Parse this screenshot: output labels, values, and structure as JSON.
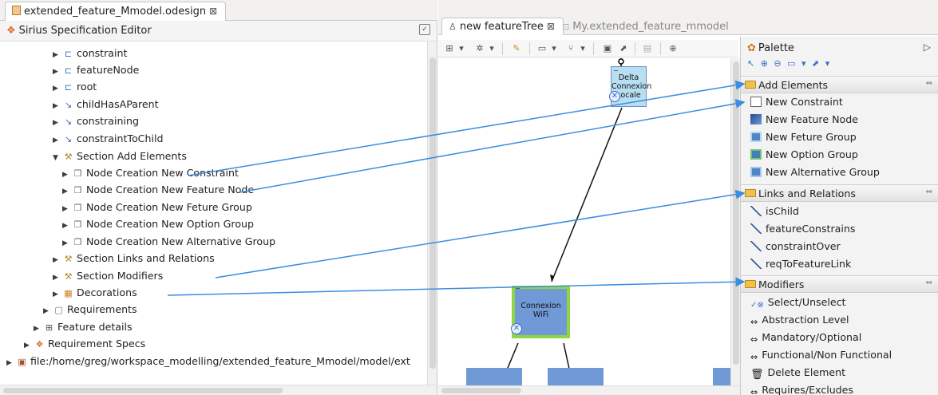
{
  "left_editor": {
    "tab_title": "extended_feature_Mmodel.odesign",
    "tab_close": "⊠",
    "header_title": "Sirius Specification Editor",
    "tree": [
      {
        "label": "constraint",
        "icon": "node-mapping-icon"
      },
      {
        "label": "featureNode",
        "icon": "node-mapping-icon"
      },
      {
        "label": "root",
        "icon": "node-mapping-icon"
      },
      {
        "label": "childHasAParent",
        "icon": "edge-mapping-icon"
      },
      {
        "label": "constraining",
        "icon": "edge-mapping-icon"
      },
      {
        "label": "constraintToChild",
        "icon": "edge-mapping-icon"
      },
      {
        "label": "Section Add Elements",
        "icon": "section-icon"
      },
      {
        "label": "Node Creation New Constraint",
        "icon": "node-creation-icon"
      },
      {
        "label": "Node Creation New Feature Node",
        "icon": "node-creation-icon"
      },
      {
        "label": "Node Creation New Feture Group",
        "icon": "node-creation-icon"
      },
      {
        "label": "Node Creation New Option Group",
        "icon": "node-creation-icon"
      },
      {
        "label": "Node Creation New Alternative Group",
        "icon": "node-creation-icon"
      },
      {
        "label": "Section Links and Relations",
        "icon": "section-icon"
      },
      {
        "label": "Section Modifiers",
        "icon": "section-icon"
      },
      {
        "label": "Decorations",
        "icon": "decorations-icon"
      },
      {
        "label": "Requirements",
        "icon": "layer-icon"
      },
      {
        "label": "Feature details",
        "icon": "table-icon"
      },
      {
        "label": "Requirement Specs",
        "icon": "sirius-icon"
      },
      {
        "label": "file:/home/greg/workspace_modelling/extended_feature_Mmodel/model/ext",
        "icon": "resource-icon"
      }
    ]
  },
  "diagram_editor": {
    "tab_active": "new featureTree",
    "tab_active_close": "⊠",
    "tab_inactive": "My.extended_feature_mmodel",
    "nodes": {
      "delta": "Delta Connexion Locale",
      "wifi": "Connexion WiFi"
    }
  },
  "palette": {
    "title": "Palette",
    "collapse_arrow": "▷",
    "tools_row": "↖ ⊕ ⊖ ▭ ▾ ⬈ ▾",
    "drawers": [
      {
        "label": "Add Elements",
        "items": [
          "New Constraint",
          "New Feature Node",
          "New Feture Group",
          "New Option Group",
          "New Alternative Group"
        ]
      },
      {
        "label": "Links and Relations",
        "items": [
          "isChild",
          "featureConstrains",
          "constraintOver",
          "reqToFeatureLink"
        ]
      },
      {
        "label": "Modifiers",
        "items": [
          "Select/Unselect",
          "Abstraction Level",
          "Mandatory/Optional",
          "Functional/Non Functional",
          "Delete Element",
          "Requires/Excludes"
        ]
      }
    ],
    "drawer_pin": "⇔"
  },
  "colors": {
    "arrow": "#3b8de0",
    "node_blue": "#6f9ad6",
    "node_light": "#b7dff1",
    "selection_green": "#8fd545"
  }
}
